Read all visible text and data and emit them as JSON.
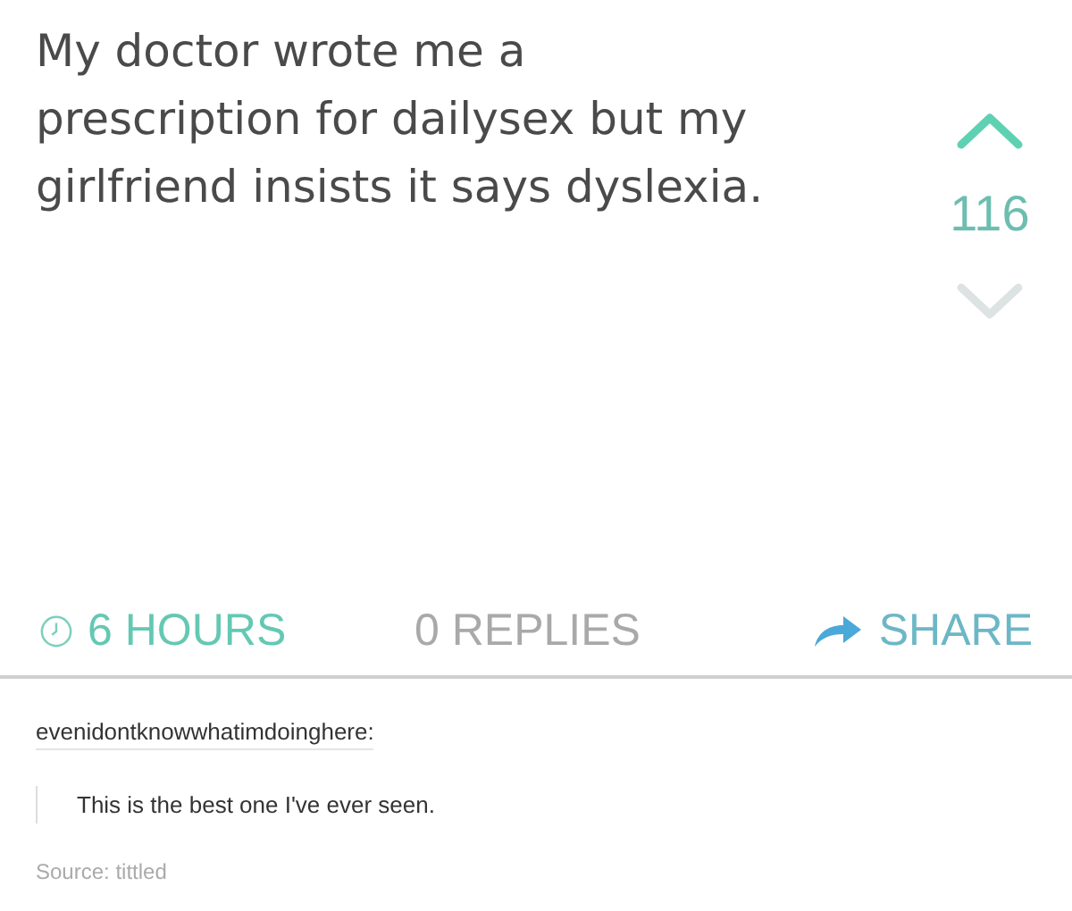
{
  "post": {
    "text_lines": [
      "My doctor wrote me a",
      "prescription for dailysex but my",
      "girlfriend insists it says dyslexia."
    ],
    "upvoted": true,
    "score": "116",
    "downvoted": false,
    "time": "6 HOURS",
    "replies": "0 REPLIES",
    "share": "SHARE"
  },
  "reblog": {
    "username": "evenidontknowwhatimdoinghere:",
    "comment": "This is the best one I've ever seen.",
    "source": "Source: tittled"
  }
}
